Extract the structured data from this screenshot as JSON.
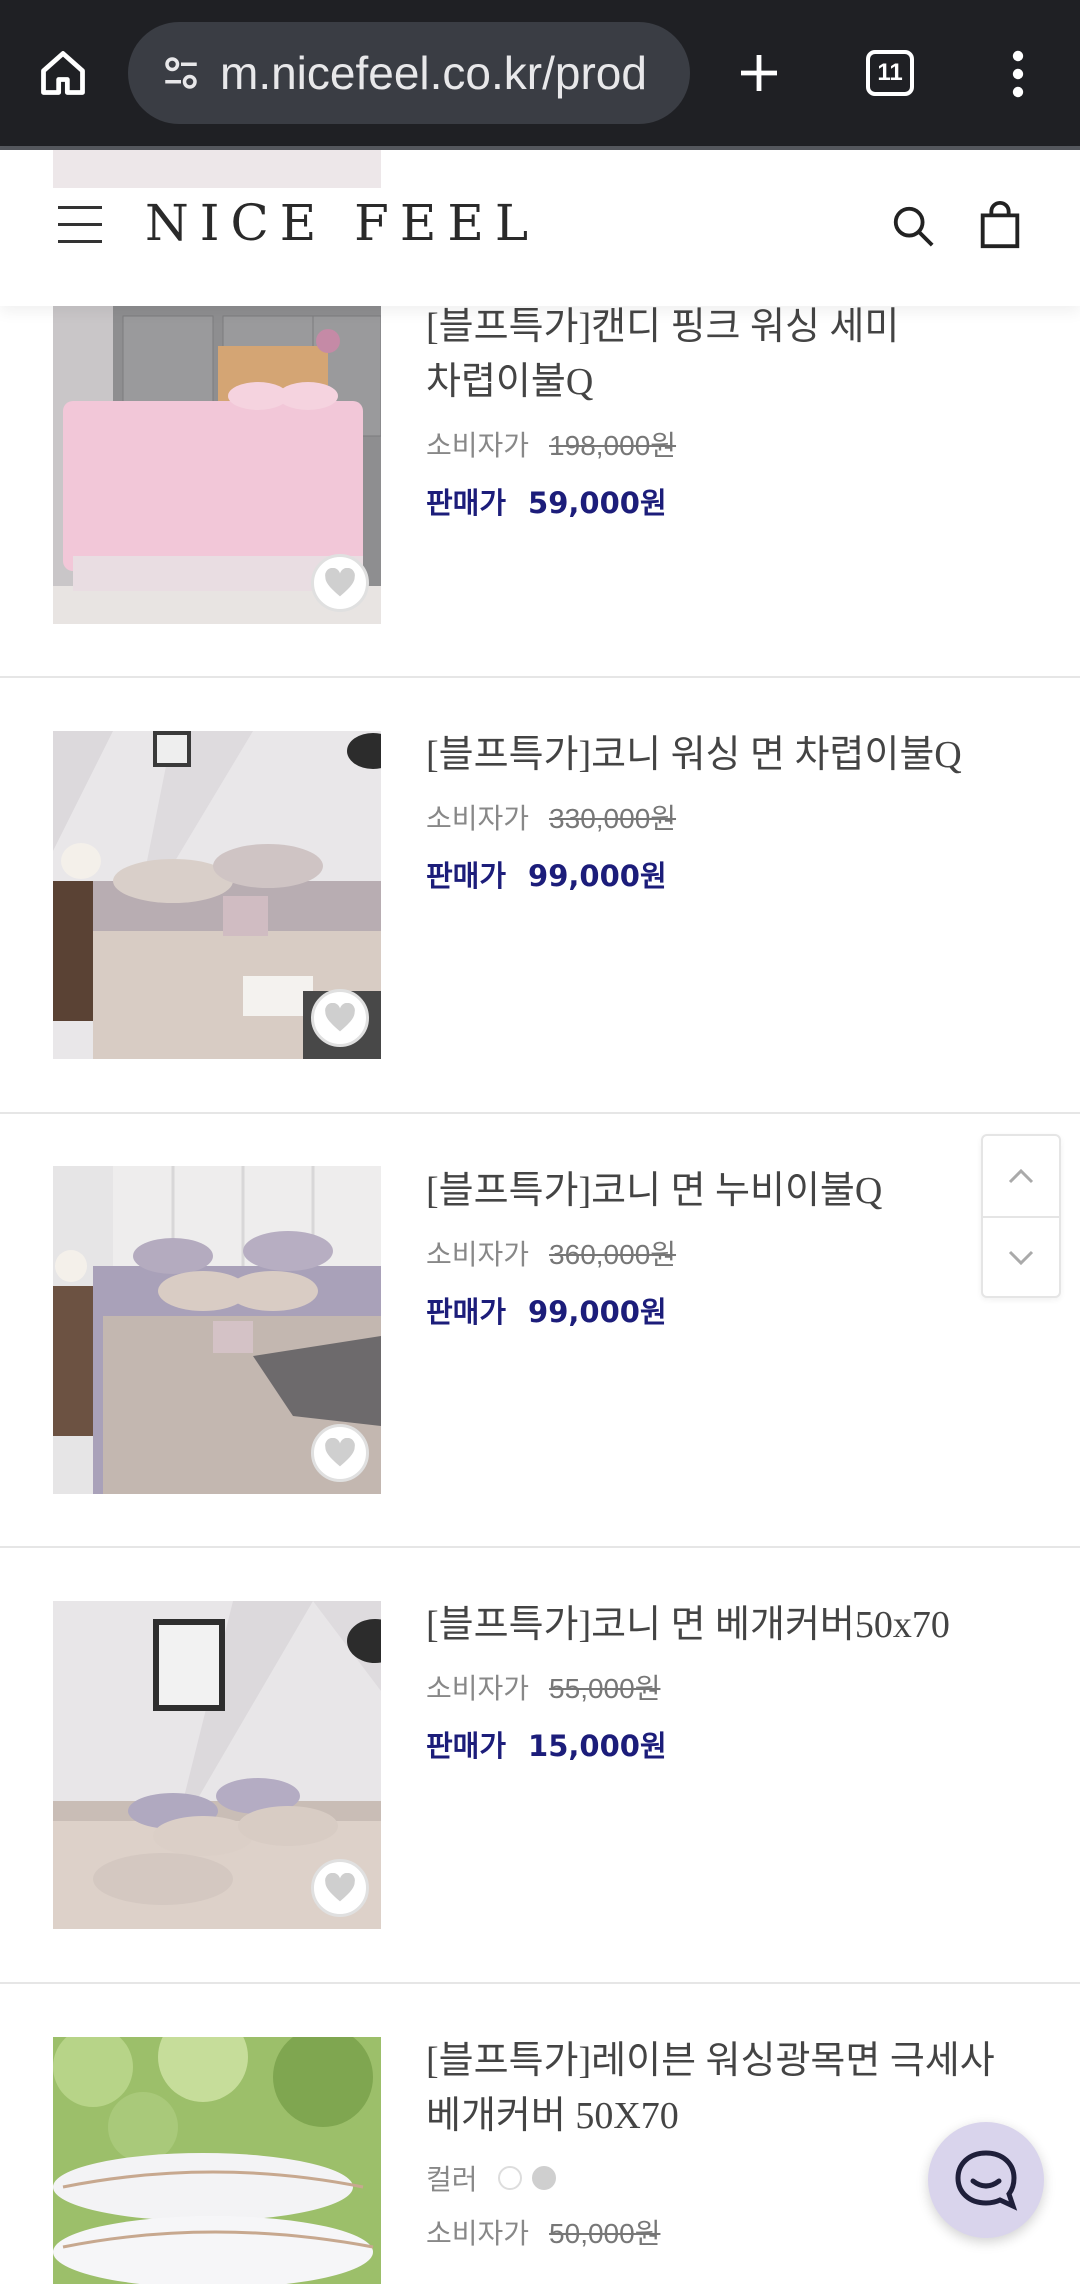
{
  "browser": {
    "url": "m.nicefeel.co.kr/prod",
    "tab_count": "11"
  },
  "site": {
    "logo": "NICE FEEL"
  },
  "products": [
    {
      "name_line1": "[블프특가]캔디 핑크 워싱 세미",
      "name_line2": "차렵이불Q",
      "list_label": "소비자가",
      "list_price": "198,000원",
      "sale_label": "판매가",
      "sale_price": "59,000원"
    },
    {
      "name_line1": "[블프특가]코니 워싱 면 차렵이불Q",
      "list_label": "소비자가",
      "list_price": "330,000원",
      "sale_label": "판매가",
      "sale_price": "99,000원"
    },
    {
      "name_line1": "[블프특가]코니 면 누비이불Q",
      "list_label": "소비자가",
      "list_price": "360,000원",
      "sale_label": "판매가",
      "sale_price": "99,000원"
    },
    {
      "name_line1": "[블프특가]코니 면 베개커버50x70",
      "list_label": "소비자가",
      "list_price": "55,000원",
      "sale_label": "판매가",
      "sale_price": "15,000원"
    },
    {
      "name_line1": "[블프특가]레이븐 워싱광목면 극세사",
      "name_line2": "베개커버 50X70",
      "color_label": "컬러",
      "colors": [
        "#ffffff",
        "#cfcfcf"
      ],
      "list_label": "소비자가",
      "list_price": "50,000원"
    }
  ],
  "colors": {
    "sale_price": "#1c1d7a",
    "browser_bar": "#1f2024",
    "chat_button": "#d9d4ec"
  }
}
